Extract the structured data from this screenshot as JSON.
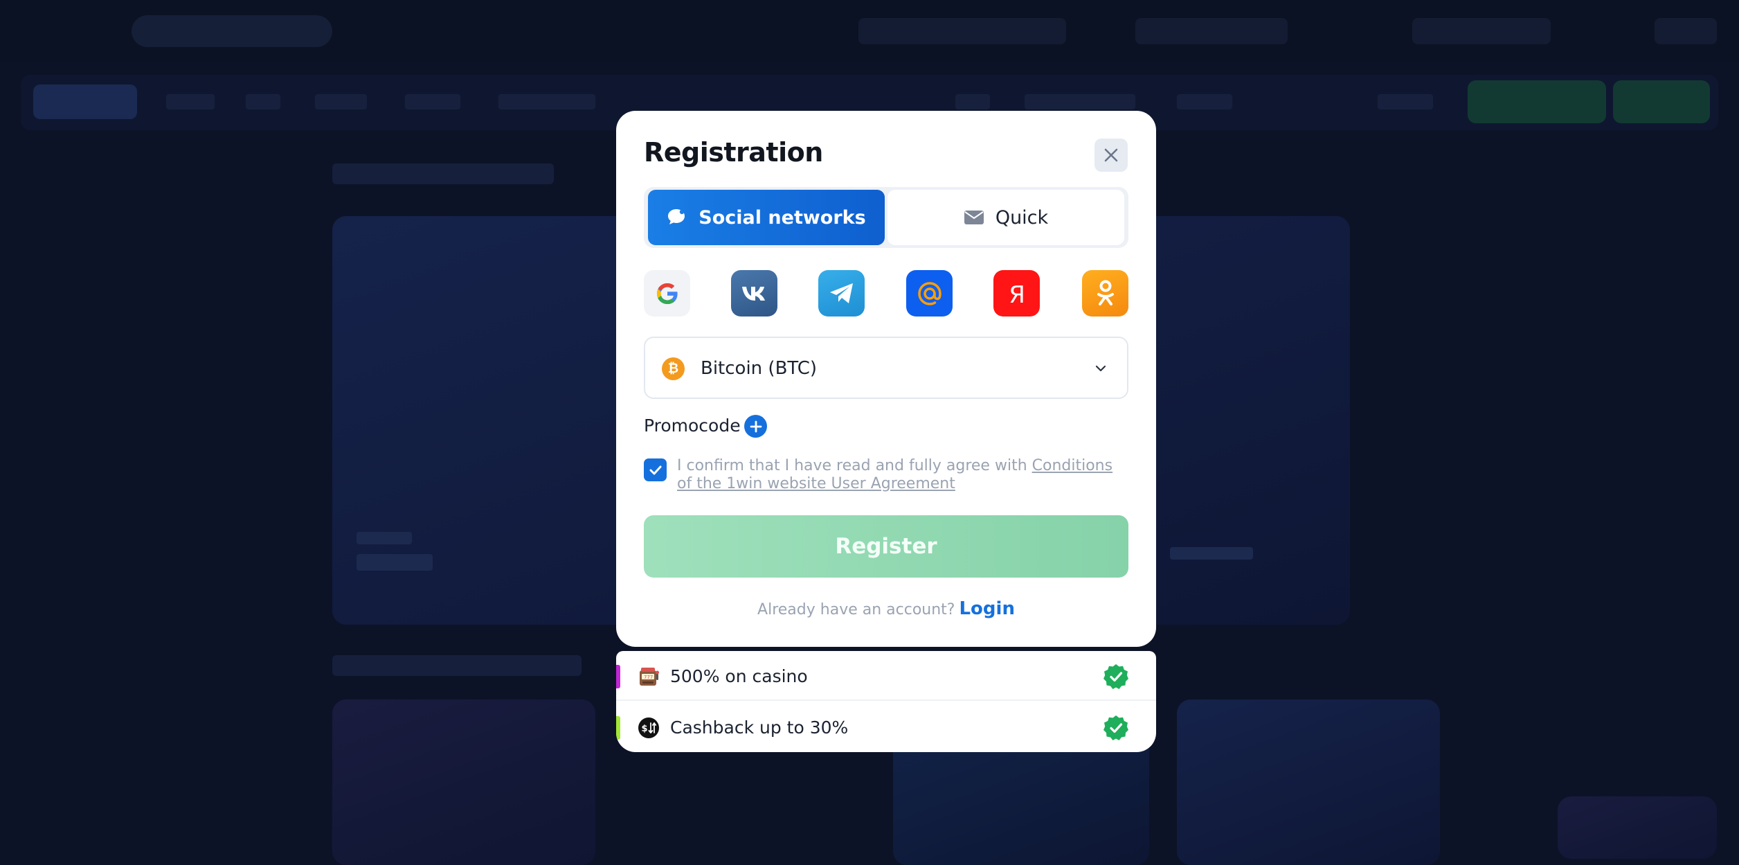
{
  "modal": {
    "title": "Registration",
    "tabs": [
      {
        "label": "Social networks",
        "icon": "chat-bubble-icon",
        "active": true
      },
      {
        "label": "Quick",
        "icon": "envelope-icon",
        "active": false
      }
    ],
    "social_providers": [
      {
        "name": "google",
        "color": "#f1f3f6"
      },
      {
        "name": "vk",
        "color": "#3a6597"
      },
      {
        "name": "telegram",
        "color": "#2a9fe0"
      },
      {
        "name": "mail-ru",
        "color": "#0d5ff0"
      },
      {
        "name": "yandex",
        "color": "#ff1515"
      },
      {
        "name": "odnoklassniki",
        "color": "#f7931e"
      }
    ],
    "currency": {
      "icon_glyph": "₿",
      "label": "Bitcoin (BTC)"
    },
    "promocode_label": "Promocode",
    "agreement": {
      "checked": true,
      "text": "I confirm that I have read and fully agree with ",
      "link": "Conditions of the 1win website User Agreement"
    },
    "register_label": "Register",
    "login_prompt": "Already have an account?",
    "login_link": "Login"
  },
  "bonuses": [
    {
      "label": "500% on casino",
      "icon": "slot-machine-icon",
      "accent": "#c026d3"
    },
    {
      "label": "Cashback up to 30%",
      "icon": "cashback-icon",
      "accent": "#a3e635"
    }
  ],
  "colors": {
    "primary": "#1570dd",
    "register_disabled": "#8fd6ae",
    "verified_green": "#1fae5b"
  }
}
